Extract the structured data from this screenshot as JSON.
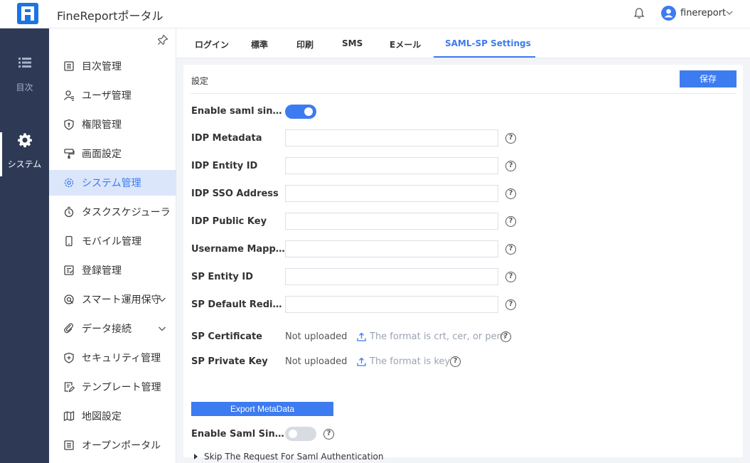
{
  "header": {
    "app_title": "FineReportポータル",
    "user_name": "finereport"
  },
  "rail": {
    "items": [
      {
        "label": "目次",
        "icon": "list-icon"
      },
      {
        "label": "システム",
        "icon": "gear-icon",
        "active": true
      }
    ]
  },
  "sidebar": {
    "items": [
      {
        "label": "目次管理",
        "icon": "directory-icon"
      },
      {
        "label": "ユーザ管理",
        "icon": "user-icon"
      },
      {
        "label": "権限管理",
        "icon": "shield-icon"
      },
      {
        "label": "画面設定",
        "icon": "paint-icon"
      },
      {
        "label": "システム管理",
        "icon": "gear-icon",
        "active": true
      },
      {
        "label": "タスクスケジューラ",
        "icon": "clock-icon"
      },
      {
        "label": "モバイル管理",
        "icon": "mobile-icon"
      },
      {
        "label": "登録管理",
        "icon": "registration-icon"
      },
      {
        "label": "スマート運用保守",
        "icon": "maintenance-icon",
        "expandable": true
      },
      {
        "label": "データ接続",
        "icon": "link-icon",
        "expandable": true
      },
      {
        "label": "セキュリティ管理",
        "icon": "security-icon"
      },
      {
        "label": "テンプレート管理",
        "icon": "template-icon"
      },
      {
        "label": "地図設定",
        "icon": "map-icon"
      },
      {
        "label": "オープンポータル",
        "icon": "portal-icon"
      }
    ]
  },
  "tabs": {
    "items": [
      "ログイン",
      "標準",
      "印刷",
      "SMS",
      "Eメール",
      "SAML-SP Settings"
    ],
    "active_index": 5
  },
  "panel": {
    "title": "設定",
    "save_label": "保存",
    "enable_sso_label": "Enable saml single···",
    "enable_sso_on": true,
    "fields": [
      {
        "label": "IDP Metadata",
        "value": ""
      },
      {
        "label": "IDP Entity ID",
        "value": ""
      },
      {
        "label": "IDP SSO Address",
        "value": ""
      },
      {
        "label": "IDP Public Key",
        "value": ""
      },
      {
        "label": "Username Mapping",
        "value": ""
      },
      {
        "label": "SP Entity ID",
        "value": ""
      },
      {
        "label": "SP Default Redirec···",
        "value": ""
      }
    ],
    "sp_certificate": {
      "label": "SP Certificate",
      "status": "Not uploaded",
      "hint": "The format is crt, cer, or pem"
    },
    "sp_private_key": {
      "label": "SP Private Key",
      "status": "Not uploaded",
      "hint": "The format is key"
    },
    "export_label": "Export MetaData",
    "enable_slo_label": "Enable Saml Singl···",
    "enable_slo_on": false,
    "skip_label": "Skip The Request For Saml Authentication"
  },
  "colors": {
    "accent": "#3d7bf0",
    "rail_bg": "#2e3a55",
    "active_bg": "#dbe6fb"
  }
}
